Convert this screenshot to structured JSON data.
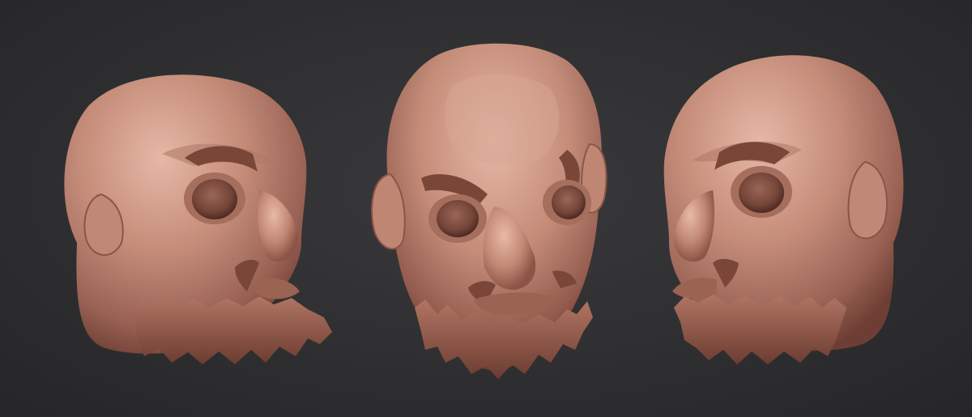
{
  "scene": {
    "background_color": "#2e2e30",
    "clay_color": "#c08a78",
    "clay_shadow_color": "#6e3e34",
    "clay_highlight_color": "#e2b2a0",
    "views": [
      {
        "id": "left-three-quarter",
        "kind": "sculpted-head",
        "facing": "right"
      },
      {
        "id": "front",
        "kind": "sculpted-head",
        "facing": "front"
      },
      {
        "id": "right-three-quarter",
        "kind": "sculpted-head",
        "facing": "left"
      }
    ]
  }
}
